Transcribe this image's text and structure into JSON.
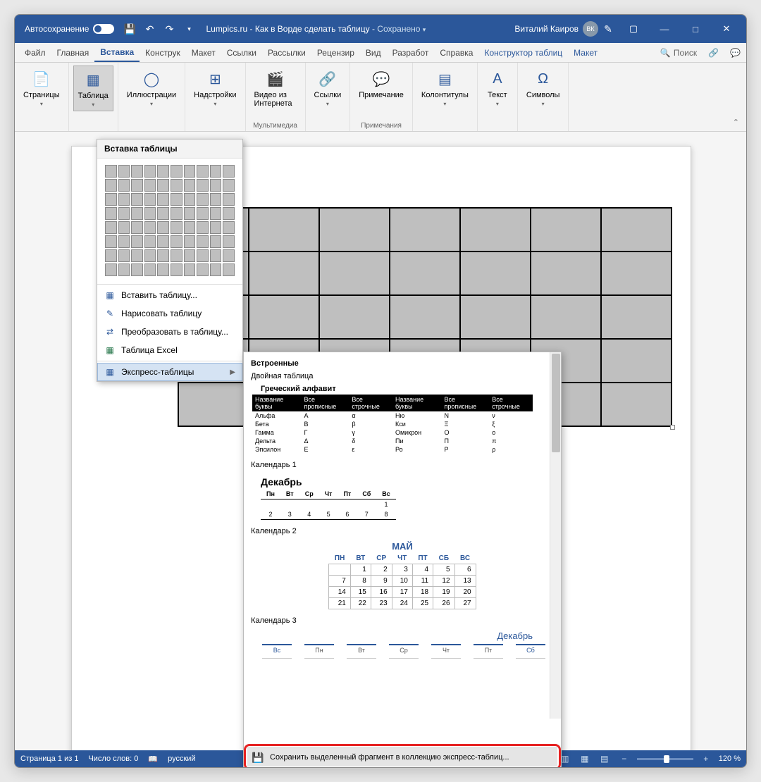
{
  "titlebar": {
    "autosave": "Автосохранение",
    "doc_title": "Lumpics.ru - Как в Ворде сделать таблицу",
    "saved": "Сохранено",
    "user": "Виталий Каиров",
    "initials": "ВК"
  },
  "tabs": {
    "file": "Файл",
    "home": "Главная",
    "insert": "Вставка",
    "design": "Конструк",
    "layout": "Макет",
    "references": "Ссылки",
    "mailings": "Рассылки",
    "review": "Рецензир",
    "view": "Вид",
    "developer": "Разработ",
    "help": "Справка",
    "table_design": "Конструктор таблиц",
    "table_layout": "Макет",
    "search": "Поиск"
  },
  "ribbon": {
    "pages": "Страницы",
    "table": "Таблица",
    "illustrations": "Иллюстрации",
    "addins": "Надстройки",
    "video": "Видео из Интернета",
    "media_grp": "Мультимедиа",
    "links": "Ссылки",
    "comment": "Примечание",
    "comments_grp": "Примечания",
    "headerfooter": "Колонтитулы",
    "text": "Текст",
    "symbols": "Символы"
  },
  "table_menu": {
    "title": "Вставка таблицы",
    "insert": "Вставить таблицу...",
    "draw": "Нарисовать таблицу",
    "convert": "Преобразовать в таблицу...",
    "excel": "Таблица Excel",
    "quick": "Экспресс-таблицы"
  },
  "gallery": {
    "builtin": "Встроенные",
    "double_table": "Двойная таблица",
    "greek_title": "Греческий алфавит",
    "greek_headers": [
      "Название буквы",
      "Все прописные",
      "Все строчные",
      "Название буквы",
      "Все прописные",
      "Все строчные"
    ],
    "greek_rows": [
      [
        "Альфа",
        "A",
        "α",
        "Ню",
        "N",
        "ν"
      ],
      [
        "Бета",
        "B",
        "β",
        "Кси",
        "Ξ",
        "ξ"
      ],
      [
        "Гамма",
        "Γ",
        "γ",
        "Омикрон",
        "O",
        "o"
      ],
      [
        "Дельта",
        "Δ",
        "δ",
        "Пи",
        "Π",
        "π"
      ],
      [
        "Эпсилон",
        "E",
        "ε",
        "Ро",
        "P",
        "ρ"
      ]
    ],
    "cal1": "Календарь 1",
    "cal1_month": "Декабрь",
    "cal1_days": [
      "Пн",
      "Вт",
      "Ср",
      "Чт",
      "Пт",
      "Сб",
      "Вс"
    ],
    "cal1_r1": [
      "",
      "",
      "",
      "",
      "",
      "",
      "1"
    ],
    "cal1_r2": [
      "2",
      "3",
      "4",
      "5",
      "6",
      "7",
      "8"
    ],
    "cal2": "Календарь 2",
    "cal2_month": "МАЙ",
    "cal2_days": [
      "ПН",
      "ВТ",
      "СР",
      "ЧТ",
      "ПТ",
      "СБ",
      "ВС"
    ],
    "cal2_rows": [
      [
        "",
        "1",
        "2",
        "3",
        "4",
        "5",
        "6"
      ],
      [
        "7",
        "8",
        "9",
        "10",
        "11",
        "12",
        "13"
      ],
      [
        "14",
        "15",
        "16",
        "17",
        "18",
        "19",
        "20"
      ],
      [
        "21",
        "22",
        "23",
        "24",
        "25",
        "26",
        "27"
      ]
    ],
    "cal3": "Календарь 3",
    "cal3_month": "Декабрь",
    "cal3_days": [
      "Вс",
      "Пн",
      "Вт",
      "Ср",
      "Чт",
      "Пт",
      "Сб"
    ],
    "save": "Сохранить выделенный фрагмент в коллекцию экспресс-таблиц..."
  },
  "statusbar": {
    "page": "Страница 1 из 1",
    "words": "Число слов: 0",
    "lang": "русский",
    "zoom": "120 %"
  }
}
